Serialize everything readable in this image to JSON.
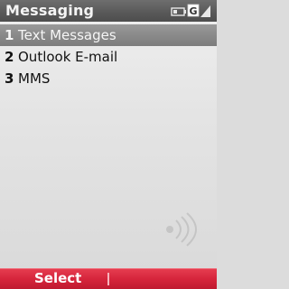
{
  "header": {
    "title": "Messaging",
    "icons": [
      "battery-icon",
      "gprs-icon",
      "signal-strength-icon"
    ],
    "network_badge": "G"
  },
  "menu": {
    "items": [
      {
        "number": "1",
        "label": "Text Messages",
        "selected": true
      },
      {
        "number": "2",
        "label": "Outlook E-mail",
        "selected": false
      },
      {
        "number": "3",
        "label": "MMS",
        "selected": false
      }
    ]
  },
  "softkeys": {
    "left_label": "Select",
    "right_label": ""
  },
  "watermark": {
    "icon": "phonearena-watermark"
  },
  "colors": {
    "titlebar": "#5a5a5a",
    "selection": "#8a8a8a",
    "softkey_bar": "#d4233a",
    "background": "#e4e4e4"
  }
}
